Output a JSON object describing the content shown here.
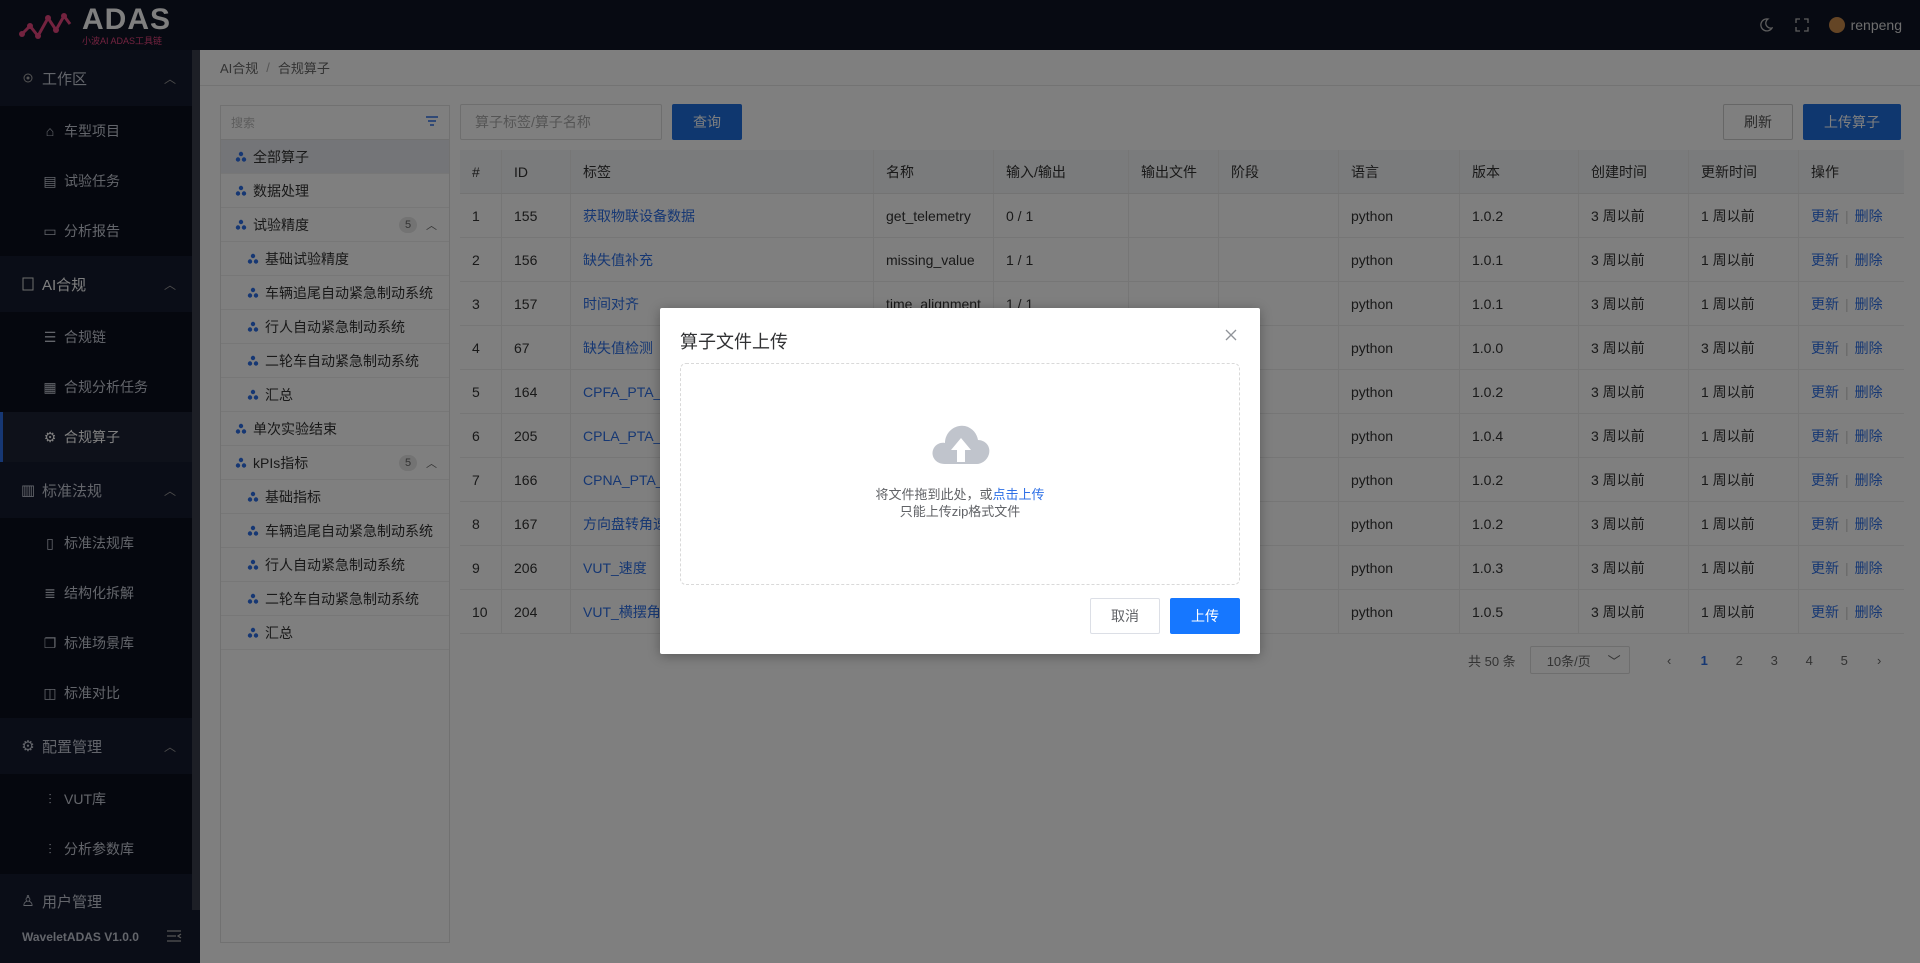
{
  "app": {
    "logo_text": "ADAS",
    "logo_subtitle": "小波AI ADAS工具链",
    "user": "renpeng",
    "version": "WaveletADAS  V1.0.0"
  },
  "sidebar": {
    "sections": [
      {
        "label": "工作区",
        "items": [
          "车型项目",
          "试验任务",
          "分析报告"
        ]
      },
      {
        "label": "AI合规",
        "items": [
          "合规链",
          "合规分析任务",
          "合规算子"
        ]
      },
      {
        "label": "标准法规",
        "items": [
          "标准法规库",
          "结构化拆解",
          "标准场景库",
          "标准对比"
        ]
      },
      {
        "label": "配置管理",
        "items": [
          "VUT库",
          "分析参数库"
        ]
      }
    ],
    "user_mgmt": "用户管理"
  },
  "breadcrumb": {
    "root": "AI合规",
    "current": "合规算子"
  },
  "tree": {
    "search_placeholder": "搜索",
    "items": [
      {
        "label": "全部算子"
      },
      {
        "label": "数据处理"
      },
      {
        "label": "试验精度",
        "count": "5"
      },
      {
        "label": "基础试验精度"
      },
      {
        "label": "车辆追尾自动紧急制动系统"
      },
      {
        "label": "行人自动紧急制动系统"
      },
      {
        "label": "二轮车自动紧急制动系统"
      },
      {
        "label": "汇总"
      },
      {
        "label": "单次实验结束"
      },
      {
        "label": "kPIs指标",
        "count": "5"
      },
      {
        "label": "基础指标"
      },
      {
        "label": "车辆追尾自动紧急制动系统"
      },
      {
        "label": "行人自动紧急制动系统"
      },
      {
        "label": "二轮车自动紧急制动系统"
      },
      {
        "label": "汇总"
      }
    ]
  },
  "toolbar": {
    "search_placeholder": "算子标签/算子名称",
    "query": "查询",
    "refresh": "刷新",
    "upload": "上传算子"
  },
  "table": {
    "headers": [
      "#",
      "ID",
      "标签",
      "名称",
      "输入/输出",
      "输出文件",
      "阶段",
      "语言",
      "版本",
      "创建时间",
      "更新时间",
      "操作"
    ],
    "rows": [
      [
        "1",
        "155",
        "获取物联设备数据",
        "get_telemetry",
        "0 / 1",
        "",
        "",
        "python",
        "1.0.2",
        "3 周以前",
        "1 周以前"
      ],
      [
        "2",
        "156",
        "缺失值补充",
        "missing_value",
        "1 / 1",
        "",
        "",
        "python",
        "1.0.1",
        "3 周以前",
        "1 周以前"
      ],
      [
        "3",
        "157",
        "时间对齐",
        "time_alignment",
        "1 / 1",
        "",
        "",
        "python",
        "1.0.1",
        "3 周以前",
        "1 周以前"
      ],
      [
        "4",
        "67",
        "缺失值检测",
        "",
        "",
        "",
        "",
        "python",
        "1.0.0",
        "3 周以前",
        "3 周以前"
      ],
      [
        "5",
        "164",
        "CPFA_PTA_",
        "",
        "",
        "",
        "",
        "python",
        "1.0.2",
        "3 周以前",
        "1 周以前"
      ],
      [
        "6",
        "205",
        "CPLA_PTA_",
        "",
        "",
        "",
        "",
        "python",
        "1.0.4",
        "3 周以前",
        "1 周以前"
      ],
      [
        "7",
        "166",
        "CPNA_PTA_",
        "",
        "",
        "",
        "",
        "python",
        "1.0.2",
        "3 周以前",
        "1 周以前"
      ],
      [
        "8",
        "167",
        "方向盘转角速",
        "",
        "",
        "",
        "",
        "python",
        "1.0.2",
        "3 周以前",
        "1 周以前"
      ],
      [
        "9",
        "206",
        "VUT_速度",
        "",
        "",
        "",
        "",
        "python",
        "1.0.3",
        "3 周以前",
        "1 周以前"
      ],
      [
        "10",
        "204",
        "VUT_横摆角",
        "",
        "",
        "",
        "",
        "python",
        "1.0.5",
        "3 周以前",
        "1 周以前"
      ]
    ],
    "op_update": "更新",
    "op_delete": "删除"
  },
  "pager": {
    "total": "共 50 条",
    "size": "10条/页",
    "pages": [
      "1",
      "2",
      "3",
      "4",
      "5"
    ]
  },
  "dialog": {
    "title": "算子文件上传",
    "drop_text": "将文件拖到此处，或",
    "drop_link": "点击上传",
    "hint": "只能上传zip格式文件",
    "cancel": "取消",
    "ok": "上传"
  },
  "colors": {
    "primary": "#1f6fde",
    "sidebar": "#141a2e",
    "topbar": "#0f1425",
    "logo_accent": "#e6467f"
  }
}
